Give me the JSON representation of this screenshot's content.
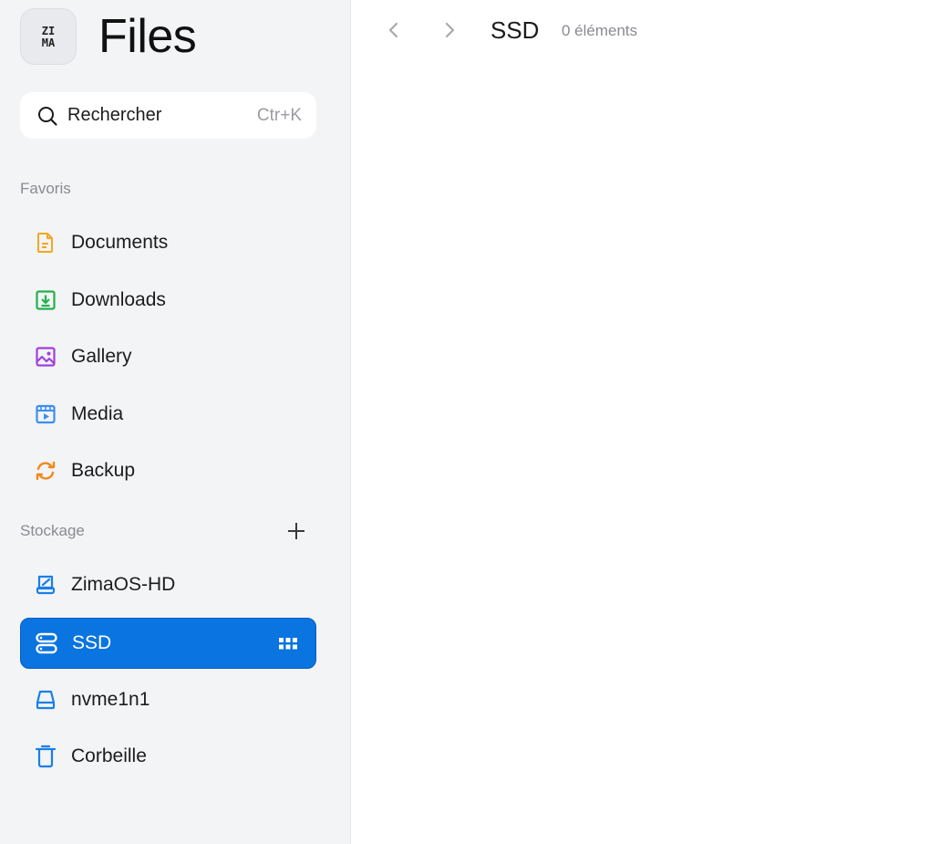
{
  "app": {
    "logo_text_top": "ZI",
    "logo_text_bottom": "MA",
    "title": "Files"
  },
  "search": {
    "label": "Rechercher",
    "shortcut": "Ctr+K"
  },
  "sidebar": {
    "favorites_title": "Favoris",
    "favorites": [
      {
        "label": "Documents",
        "icon": "document-icon",
        "color": "#f5a623"
      },
      {
        "label": "Downloads",
        "icon": "download-icon",
        "color": "#22b14c"
      },
      {
        "label": "Gallery",
        "icon": "gallery-icon",
        "color": "#a040e0"
      },
      {
        "label": "Media",
        "icon": "media-icon",
        "color": "#3b8ff0"
      },
      {
        "label": "Backup",
        "icon": "backup-icon",
        "color": "#f08a1c"
      }
    ],
    "storage_title": "Stockage",
    "storage": [
      {
        "label": "ZimaOS-HD",
        "icon": "hard-drive-icon",
        "color": "#1a7fe8"
      },
      {
        "label": "SSD",
        "icon": "storage-icon",
        "color": "#ffffff",
        "active": true
      },
      {
        "label": "nvme1n1",
        "icon": "disk-icon",
        "color": "#1a7fe8"
      },
      {
        "label": "Corbeille",
        "icon": "trash-icon",
        "color": "#1a7fe8"
      }
    ]
  },
  "main": {
    "current_folder": "SSD",
    "item_count": "0 éléments"
  },
  "colors": {
    "accent": "#0a74e0",
    "sidebar_bg": "#f3f4f6"
  }
}
